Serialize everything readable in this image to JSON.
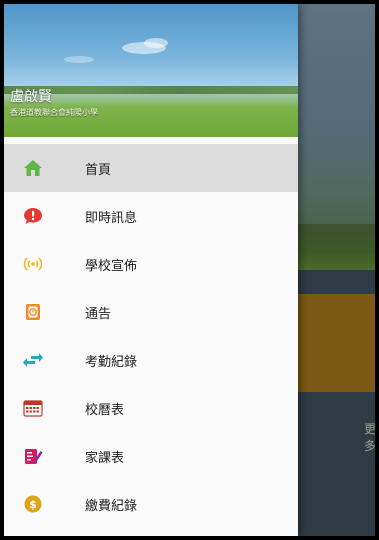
{
  "drawer": {
    "user_name": "盧啟賢",
    "school_name": "香港道教聯合會純陽小學",
    "items": [
      {
        "label": "首頁",
        "icon": "home-icon",
        "active": true
      },
      {
        "label": "即時訊息",
        "icon": "message-alert-icon",
        "active": false
      },
      {
        "label": "學校宣佈",
        "icon": "broadcast-icon",
        "active": false
      },
      {
        "label": "通告",
        "icon": "notice-icon",
        "active": false
      },
      {
        "label": "考勤紀錄",
        "icon": "attendance-arrows-icon",
        "active": false
      },
      {
        "label": "校曆表",
        "icon": "calendar-icon",
        "active": false
      },
      {
        "label": "家課表",
        "icon": "homework-icon",
        "active": false
      },
      {
        "label": "繳費紀錄",
        "icon": "payment-coin-icon",
        "active": false
      }
    ]
  },
  "background": {
    "more_label": "更多"
  },
  "colors": {
    "home": "#5fb548",
    "message": "#e53935",
    "broadcast": "#f2b71b",
    "notice": "#f08a24",
    "attendance": "#2aa6b8",
    "calendar": "#c0392b",
    "homework": "#d81b60",
    "payment": "#e0a21a",
    "active_bg": "#dcdcdc"
  }
}
